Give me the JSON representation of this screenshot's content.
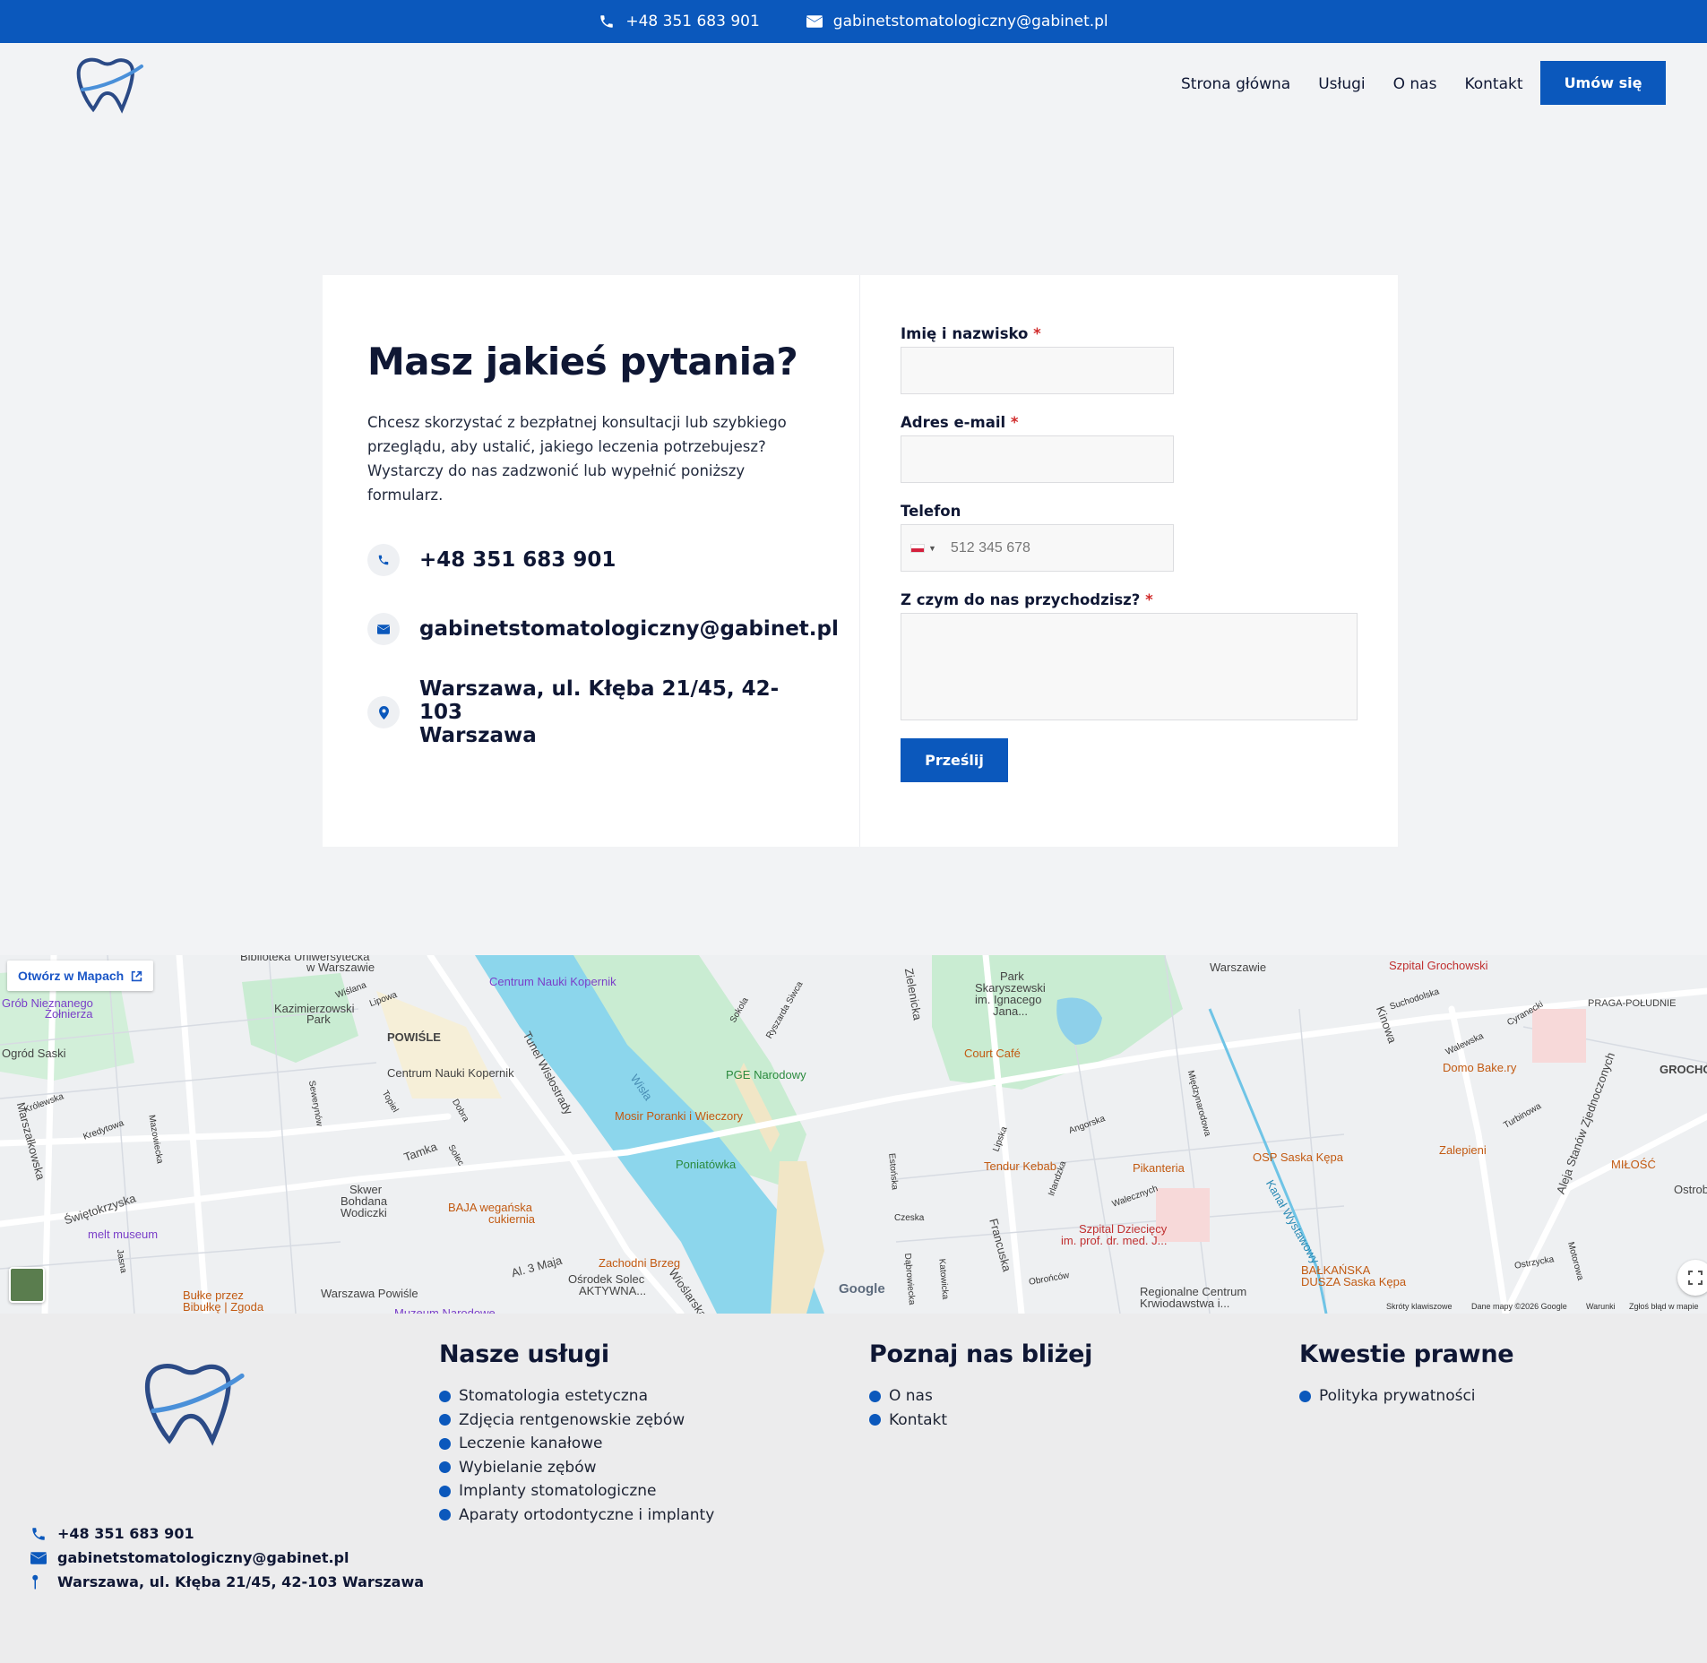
{
  "topbar": {
    "phone": "+48 351 683 901",
    "email": "gabinetstomatologiczny@gabinet.pl",
    "phone_icon": "phone-icon",
    "email_icon": "envelope-icon"
  },
  "header": {
    "logo_icon": "tooth-logo-icon",
    "nav": [
      {
        "label": "Strona główna"
      },
      {
        "label": "Usługi"
      },
      {
        "label": "O nas"
      },
      {
        "label": "Kontakt"
      }
    ],
    "cta_label": "Umów się"
  },
  "contact": {
    "title": "Masz jakieś pytania?",
    "lead": "Chcesz skorzystać z bezpłatnej konsultacji lub szybkiego przeglądu, aby ustalić, jakiego leczenia potrzebujesz? Wystarczy do nas zadzwonić lub wypełnić poniższy formularz.",
    "phone": "+48 351 683 901",
    "email": "gabinetstomatologiczny@gabinet.pl",
    "address_line1": "Warszawa, ul. Kłęba 21/45, 42-103",
    "address_line2": "Warszawa"
  },
  "form": {
    "name_label": "Imię i nazwisko",
    "email_label": "Adres e-mail",
    "phone_label": "Telefon",
    "phone_placeholder": "512 345 678",
    "message_label": "Z czym do nas przychodzisz?",
    "required_mark": "*",
    "submit_label": "Prześlij"
  },
  "map": {
    "open_label": "Otwórz w Mapach",
    "labels": [
      {
        "t": "Biblioteka Uniwersytecka"
      },
      {
        "t": "w Warszawie"
      },
      {
        "t": "Centrum Nauki Kopernik"
      },
      {
        "t": "Grób Nieznanego"
      },
      {
        "t": "Żołnierza"
      },
      {
        "t": "Kazimierzowski"
      },
      {
        "t": "Park"
      },
      {
        "t": "POWIŚLE"
      },
      {
        "t": "Ogród Saski"
      },
      {
        "t": "Centrum Nauki Kopernik"
      },
      {
        "t": "PGE Narodowy"
      },
      {
        "t": "Mosir Poranki i Wieczory"
      },
      {
        "t": "Poniatówka"
      },
      {
        "t": "Skwer"
      },
      {
        "t": "Bohdana"
      },
      {
        "t": "Wodiczki"
      },
      {
        "t": "BAJA wegańska"
      },
      {
        "t": "cukiernia"
      },
      {
        "t": "melt museum"
      },
      {
        "t": "Świętokrzyska"
      },
      {
        "t": "Zachodni Brzeg"
      },
      {
        "t": "Ośrodek Solec"
      },
      {
        "t": "AKTYWNA..."
      },
      {
        "t": "Warszawa Powiśle"
      },
      {
        "t": "Bułke przez"
      },
      {
        "t": "Bibułkę | Zgoda"
      },
      {
        "t": "Park"
      },
      {
        "t": "Skaryszewski"
      },
      {
        "t": "im. Ignacego"
      },
      {
        "t": "Jana..."
      },
      {
        "t": "Court Café"
      },
      {
        "t": "Tendur Kebab"
      },
      {
        "t": "Pikanteria"
      },
      {
        "t": "OSP Saska Kępa"
      },
      {
        "t": "Szpital Dziecięcy"
      },
      {
        "t": "im. prof. dr. med. J..."
      },
      {
        "t": "Regionalne Centrum"
      },
      {
        "t": "Krwiodawstwa i..."
      },
      {
        "t": "Szpital Grochowski"
      },
      {
        "t": "Domo Bake.ry"
      },
      {
        "t": "Zalepieni"
      },
      {
        "t": "BAŁKAŃSKA"
      },
      {
        "t": "DUSZA Saska Kępa"
      },
      {
        "t": "MIŁOŚĆ"
      },
      {
        "t": "PRAGA-POŁUDNIE"
      },
      {
        "t": "GROCHÓ"
      },
      {
        "t": "Warszawie"
      },
      {
        "t": "Wisła"
      },
      {
        "t": "Tamka"
      },
      {
        "t": "Al. 3 Maja"
      },
      {
        "t": "Francuska"
      },
      {
        "t": "Kinowa"
      },
      {
        "t": "Aleja Stanów Zjednoczonych"
      },
      {
        "t": "Marszałkowska"
      },
      {
        "t": "Królewska"
      },
      {
        "t": "Kredytowa"
      },
      {
        "t": "Mazowiecka"
      },
      {
        "t": "Jasna"
      },
      {
        "t": "Wiślana"
      },
      {
        "t": "Lipowa"
      },
      {
        "t": "Dobra"
      },
      {
        "t": "Topiel"
      },
      {
        "t": "Solec"
      },
      {
        "t": "Sewerynów"
      },
      {
        "t": "Tunel Wisłostrady"
      },
      {
        "t": "Sokola"
      },
      {
        "t": "Ryszarda Siwca"
      },
      {
        "t": "Zielenicka"
      },
      {
        "t": "Międzynarodowa"
      },
      {
        "t": "Angorska"
      },
      {
        "t": "Lipska"
      },
      {
        "t": "Estońska"
      },
      {
        "t": "Czeska"
      },
      {
        "t": "Irlandzka"
      },
      {
        "t": "Walecznych"
      },
      {
        "t": "Dąbrowiecka"
      },
      {
        "t": "Katowicka"
      },
      {
        "t": "Obrońców"
      },
      {
        "t": "Suchodolska"
      },
      {
        "t": "Cyranecki"
      },
      {
        "t": "Walewska"
      },
      {
        "t": "Turbinowa"
      },
      {
        "t": "Ostrzycka"
      },
      {
        "t": "Motorowa"
      },
      {
        "t": "Ostrob"
      },
      {
        "t": "Kanał Wystawowy"
      },
      {
        "t": "Muzeum Narodowe"
      },
      {
        "t": "Wioślarska"
      },
      {
        "t": "Google"
      },
      {
        "t": "Skróty klawiszowe"
      },
      {
        "t": "Dane mapy ©2026 Google"
      },
      {
        "t": "Warunki"
      },
      {
        "t": "Zgłoś błąd w mapie"
      }
    ]
  },
  "footer": {
    "services_title": "Nasze usługi",
    "services": [
      {
        "label": "Stomatologia estetyczna"
      },
      {
        "label": "Zdjęcia rentgenowskie zębów"
      },
      {
        "label": "Leczenie kanałowe"
      },
      {
        "label": "Wybielanie zębów"
      },
      {
        "label": "Implanty stomatologiczne"
      },
      {
        "label": "Aparaty ortodontyczne i implanty"
      }
    ],
    "about_title": "Poznaj nas bliżej",
    "about": [
      {
        "label": "O nas"
      },
      {
        "label": "Kontakt"
      }
    ],
    "legal_title": "Kwestie prawne",
    "legal": [
      {
        "label": "Polityka prywatności"
      }
    ],
    "phone": "+48 351 683 901",
    "email": "gabinetstomatologiczny@gabinet.pl",
    "address": "Warszawa, ul. Kłęba 21/45, 42-103 Warszawa"
  },
  "colors": {
    "brand": "#0b58bc",
    "text_dark": "#0f1734",
    "page_bg": "#f2f3f5",
    "footer_bg": "#ececed",
    "required": "#d12b2b"
  }
}
